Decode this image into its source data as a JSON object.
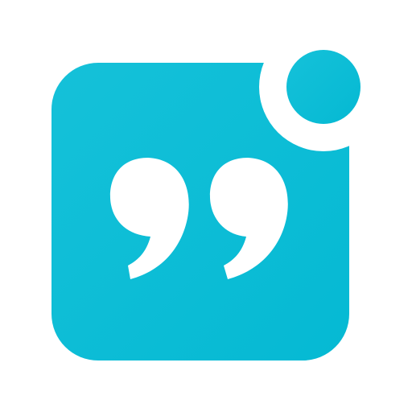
{
  "icon": {
    "name": "quote-app-icon",
    "colors": {
      "tile_top": "#15C1D9",
      "tile_bottom": "#05B9D3",
      "glyph": "#FFFFFF",
      "background": "#FFFFFF"
    },
    "parts": [
      "rounded-square-tile",
      "quotation-marks-glyph",
      "notification-dot"
    ]
  }
}
